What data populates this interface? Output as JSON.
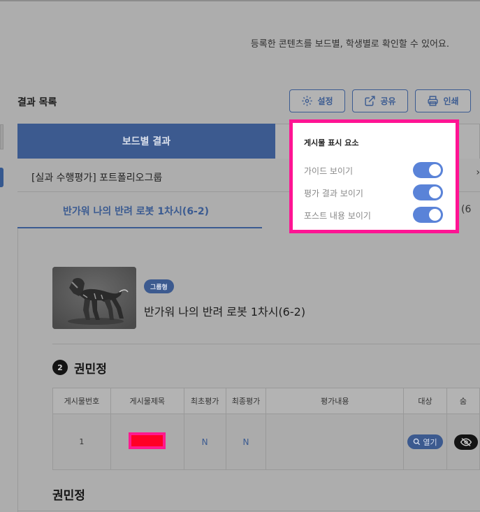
{
  "description": "등록한 콘텐츠를 보드별, 학생별로 확인할 수 있어요.",
  "results_title": "결과 목록",
  "toolbar": {
    "settings_label": "설정",
    "share_label": "공유",
    "print_label": "인쇄"
  },
  "tabs": {
    "board_results": "보드별 결과"
  },
  "group_title": "[실과 수행평가] 포트폴리오그룹",
  "subtab_label": "반가워 나의 반려 로봇 1차시(6-2)",
  "subtab_right_fragment": "(6",
  "post": {
    "badge": "그룹형",
    "title": "반가워 나의 반려 로봇 1차시(6-2)"
  },
  "student": {
    "number": "2",
    "name": "권민정"
  },
  "table": {
    "headers": [
      "게시물번호",
      "게시물제목",
      "최초평가",
      "최종평가",
      "평가내용",
      "대상",
      "숨"
    ],
    "row": {
      "number": "1",
      "first_eval": "N",
      "final_eval": "N",
      "open_label": "열기"
    }
  },
  "student2_name": "권민정",
  "popup": {
    "title": "게시물 표시 요소",
    "options": [
      {
        "label": "가이드 보이기",
        "on": true
      },
      {
        "label": "평가 결과 보이기",
        "on": true
      },
      {
        "label": "포스트 내용 보이기",
        "on": true
      }
    ]
  },
  "colors": {
    "accent": "#3c5a8f",
    "highlight": "#ff1493",
    "toggle_on": "#5a83d8"
  }
}
